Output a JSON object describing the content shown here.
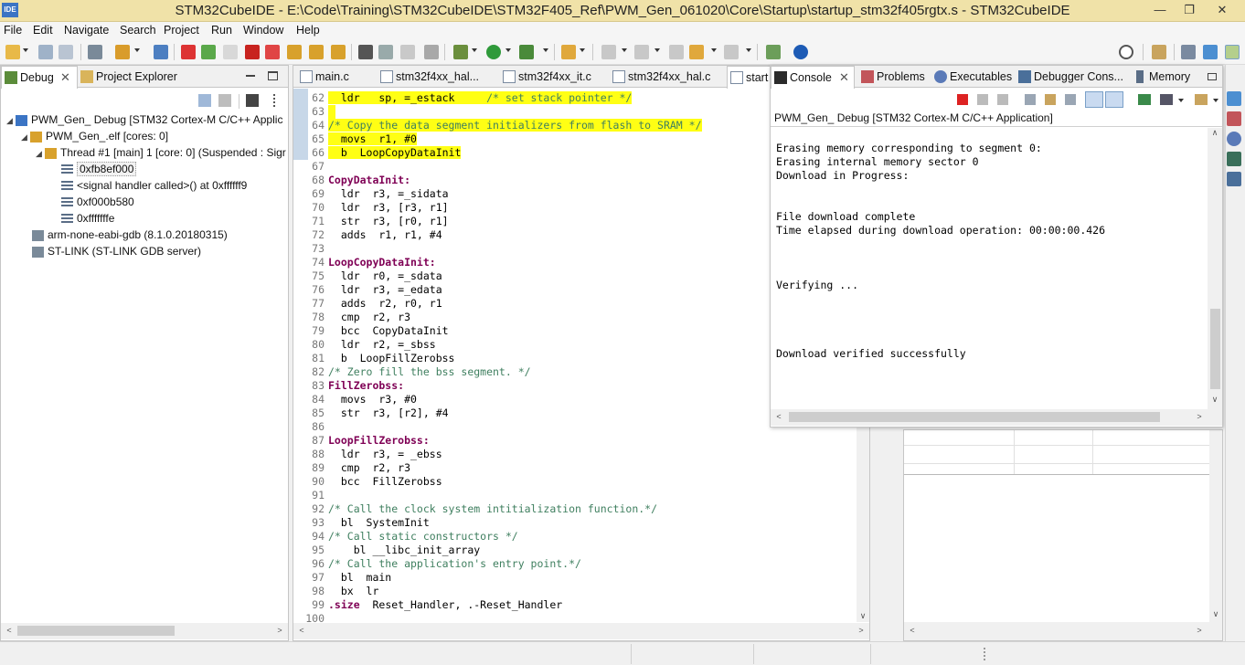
{
  "window": {
    "app_icon_text": "IDE",
    "title": "STM32CubeIDE - E:\\Code\\Training\\STM32CubeIDE\\STM32F405_Ref\\PWM_Gen_061020\\Core\\Startup\\startup_stm32f405rgtx.s - STM32CubeIDE",
    "minimize": "—",
    "maximize": "❐",
    "close": "✕"
  },
  "menu": [
    "File",
    "Edit",
    "Navigate",
    "Search",
    "Project",
    "Run",
    "Window",
    "Help"
  ],
  "debug_view": {
    "tabs": [
      {
        "label": "Debug",
        "close": "✕"
      },
      {
        "label": "Project Explorer"
      }
    ],
    "tree": [
      {
        "text": "PWM_Gen_ Debug [STM32 Cortex-M C/C++ Applic",
        "level": 0,
        "expanded": true
      },
      {
        "text": "PWM_Gen_.elf [cores: 0]",
        "level": 1,
        "expanded": true
      },
      {
        "text": "Thread #1 [main] 1 [core: 0] (Suspended : Sigr",
        "level": 2,
        "expanded": true
      },
      {
        "text": "0xfb8ef000",
        "level": 3,
        "selected": true
      },
      {
        "text": "<signal handler called>() at 0xffffff9",
        "level": 3
      },
      {
        "text": "0xf000b580",
        "level": 3
      },
      {
        "text": "0xfffffffe",
        "level": 3
      },
      {
        "text": "arm-none-eabi-gdb (8.1.0.20180315)",
        "level": 1
      },
      {
        "text": "ST-LINK (ST-LINK GDB server)",
        "level": 1
      }
    ]
  },
  "editor": {
    "tabs": [
      "main.c",
      "stm32f4xx_hal...",
      "stm32f4xx_it.c",
      "stm32f4xx_hal.c",
      "start"
    ],
    "lines": [
      {
        "n": "62",
        "text": "  ldr   sp, =_estack     ",
        "comment": "/* set stack pointer */",
        "hl": true
      },
      {
        "n": "63",
        "text": "",
        "hl": true
      },
      {
        "n": "64",
        "text": "",
        "comment": "/* Copy the data segment initializers from flash to SRAM */",
        "hl": true
      },
      {
        "n": "65",
        "text": "  movs  r1, #0",
        "hl": true
      },
      {
        "n": "66",
        "text": "  b  LoopCopyDataInit",
        "hl": true
      },
      {
        "n": "67",
        "text": ""
      },
      {
        "n": "68",
        "label": "CopyDataInit:"
      },
      {
        "n": "69",
        "text": "  ldr  r3, =_sidata"
      },
      {
        "n": "70",
        "text": "  ldr  r3, [r3, r1]"
      },
      {
        "n": "71",
        "text": "  str  r3, [r0, r1]"
      },
      {
        "n": "72",
        "text": "  adds  r1, r1, #4"
      },
      {
        "n": "73",
        "text": ""
      },
      {
        "n": "74",
        "label": "LoopCopyDataInit:"
      },
      {
        "n": "75",
        "text": "  ldr  r0, =_sdata"
      },
      {
        "n": "76",
        "text": "  ldr  r3, =_edata"
      },
      {
        "n": "77",
        "text": "  adds  r2, r0, r1"
      },
      {
        "n": "78",
        "text": "  cmp  r2, r3"
      },
      {
        "n": "79",
        "text": "  bcc  CopyDataInit"
      },
      {
        "n": "80",
        "text": "  ldr  r2, =_sbss"
      },
      {
        "n": "81",
        "text": "  b  LoopFillZerobss"
      },
      {
        "n": "82",
        "text": "",
        "comment": "/* Zero fill the bss segment. */"
      },
      {
        "n": "83",
        "label": "FillZerobss:"
      },
      {
        "n": "84",
        "text": "  movs  r3, #0"
      },
      {
        "n": "85",
        "text": "  str  r3, [r2], #4"
      },
      {
        "n": "86",
        "text": ""
      },
      {
        "n": "87",
        "label": "LoopFillZerobss:"
      },
      {
        "n": "88",
        "text": "  ldr  r3, = _ebss"
      },
      {
        "n": "89",
        "text": "  cmp  r2, r3"
      },
      {
        "n": "90",
        "text": "  bcc  FillZerobss"
      },
      {
        "n": "91",
        "text": ""
      },
      {
        "n": "92",
        "text": "",
        "comment": "/* Call the clock system intitialization function.*/"
      },
      {
        "n": "93",
        "text": "  bl  SystemInit"
      },
      {
        "n": "94",
        "text": "",
        "comment": "/* Call static constructors */"
      },
      {
        "n": "95",
        "text": "    bl __libc_init_array"
      },
      {
        "n": "96",
        "text": "",
        "comment": "/* Call the application's entry point.*/"
      },
      {
        "n": "97",
        "text": "  bl  main"
      },
      {
        "n": "98",
        "text": "  bx  lr"
      },
      {
        "n": "99",
        "dir": ".size",
        "text": "  Reset_Handler, .-Reset_Handler"
      },
      {
        "n": "100",
        "text": ""
      }
    ]
  },
  "console": {
    "tabs": [
      {
        "label": "Console",
        "close": "✕"
      },
      {
        "label": "Problems"
      },
      {
        "label": "Executables"
      },
      {
        "label": "Debugger Cons..."
      },
      {
        "label": "Memory"
      }
    ],
    "header": "PWM_Gen_ Debug [STM32 Cortex-M C/C++ Application]",
    "lines": [
      "",
      "Erasing memory corresponding to segment 0:",
      "Erasing internal memory sector 0",
      "Download in Progress:",
      "",
      "",
      "File download complete",
      "Time elapsed during download operation: 00:00:00.426",
      "",
      "",
      "",
      "Verifying ...",
      "",
      "",
      "",
      "",
      "Download verified successfully"
    ]
  },
  "colors": {
    "highlight": "#ffff14",
    "titlebar": "#f0e2a8",
    "comment": "#3f7f5f",
    "keyword": "#7f0055"
  }
}
